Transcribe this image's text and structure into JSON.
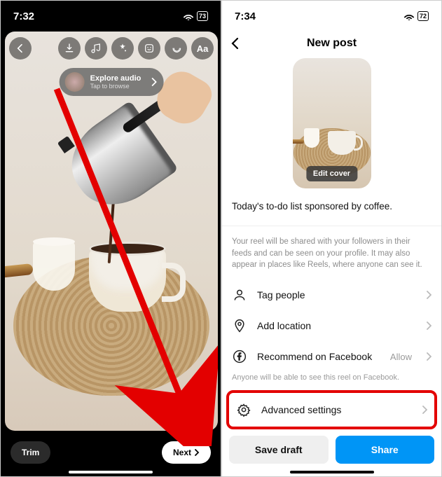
{
  "left": {
    "status": {
      "time": "7:32",
      "battery": "73"
    },
    "toolbar_icons": [
      "back-icon",
      "download-icon",
      "music-icon",
      "effects-icon",
      "sticker-icon",
      "voiceover-icon",
      "text-icon"
    ],
    "explore": {
      "title": "Explore audio",
      "subtitle": "Tap to browse"
    },
    "trim_label": "Trim",
    "next_label": "Next"
  },
  "right": {
    "status": {
      "time": "7:34",
      "battery": "72"
    },
    "header_title": "New post",
    "edit_cover_label": "Edit cover",
    "caption": "Today's to-do list sponsored by coffee.",
    "helper": "Your reel will be shared with your followers in their feeds and can be seen on your profile. It may also appear in places like Reels, where anyone can see it.",
    "tag_label": "Tag people",
    "location_label": "Add location",
    "recommend_label": "Recommend on Facebook",
    "recommend_value": "Allow",
    "recommend_sub": "Anyone will be able to see this reel on Facebook.",
    "advanced_label": "Advanced settings",
    "save_draft_label": "Save draft",
    "share_label": "Share"
  }
}
